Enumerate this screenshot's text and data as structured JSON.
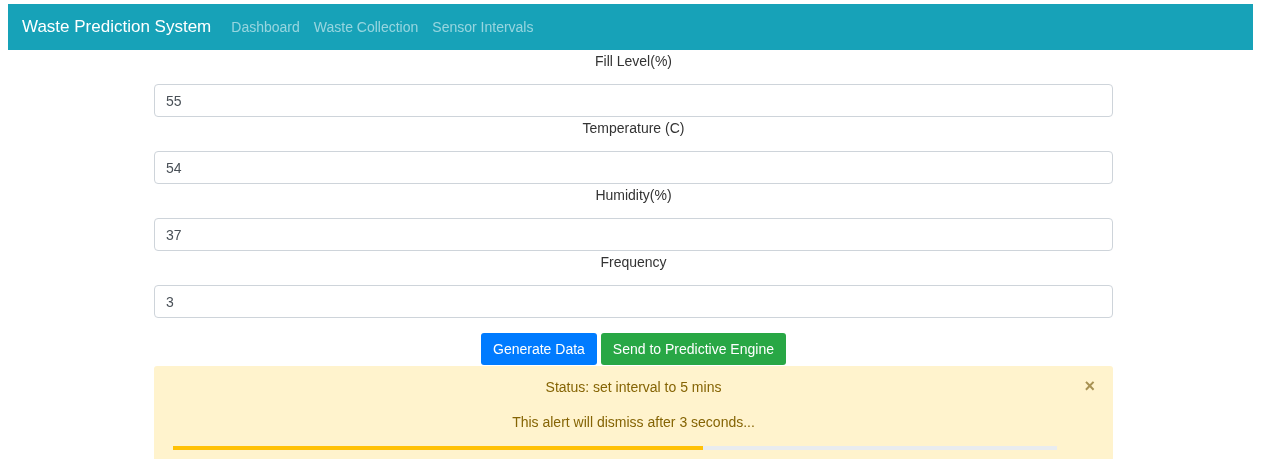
{
  "navbar": {
    "brand": "Waste Prediction System",
    "links": [
      {
        "label": "Dashboard"
      },
      {
        "label": "Waste Collection"
      },
      {
        "label": "Sensor Intervals"
      }
    ]
  },
  "fields": [
    {
      "label": "Fill Level(%)",
      "value": "55"
    },
    {
      "label": "Temperature (C)",
      "value": "54"
    },
    {
      "label": "Humidity(%)",
      "value": "37"
    },
    {
      "label": "Frequency",
      "value": "3"
    }
  ],
  "buttons": [
    {
      "label": "Generate Data",
      "kind": "primary"
    },
    {
      "label": "Send to Predictive Engine",
      "kind": "success"
    }
  ],
  "alert": {
    "status": "Status: set interval to 5 mins",
    "message": "This alert will dismiss after 3 seconds...",
    "close": "×",
    "level": 0.6
  }
}
